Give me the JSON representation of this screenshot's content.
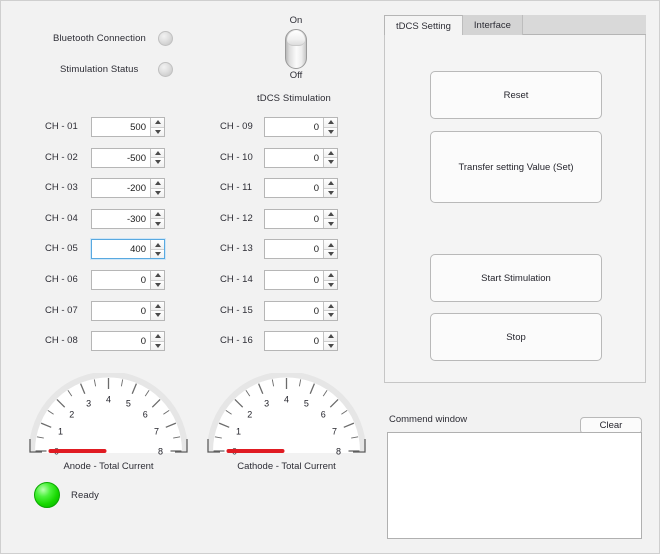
{
  "window": {
    "background": "#f2f2f2"
  },
  "status_indicators": [
    {
      "label": "Bluetooth Connection",
      "state": "off"
    },
    {
      "label": "Stimulation Status",
      "state": "off"
    }
  ],
  "toggle": {
    "on_label": "On",
    "off_label": "Off",
    "caption": "tDCS Stimulation",
    "state": "Off"
  },
  "channels_left": [
    {
      "name": "CH - 01",
      "value": "500",
      "focused": false
    },
    {
      "name": "CH - 02",
      "value": "-500",
      "focused": false
    },
    {
      "name": "CH - 03",
      "value": "-200",
      "focused": false
    },
    {
      "name": "CH - 04",
      "value": "-300",
      "focused": false
    },
    {
      "name": "CH - 05",
      "value": "400",
      "focused": true
    },
    {
      "name": "CH - 06",
      "value": "0",
      "focused": false
    },
    {
      "name": "CH - 07",
      "value": "0",
      "focused": false
    },
    {
      "name": "CH - 08",
      "value": "0",
      "focused": false
    }
  ],
  "channels_right": [
    {
      "name": "CH - 09",
      "value": "0",
      "focused": false
    },
    {
      "name": "CH - 10",
      "value": "0",
      "focused": false
    },
    {
      "name": "CH - 11",
      "value": "0",
      "focused": false
    },
    {
      "name": "CH - 12",
      "value": "0",
      "focused": false
    },
    {
      "name": "CH - 13",
      "value": "0",
      "focused": false
    },
    {
      "name": "CH - 14",
      "value": "0",
      "focused": false
    },
    {
      "name": "CH - 15",
      "value": "0",
      "focused": false
    },
    {
      "name": "CH - 16",
      "value": "0",
      "focused": false
    }
  ],
  "gauges": [
    {
      "caption": "Anode  - Total Current",
      "ticks": [
        "0",
        "1",
        "2",
        "3",
        "4",
        "5",
        "6",
        "7",
        "8"
      ],
      "min": 0,
      "max": 8,
      "value": 0,
      "needle_color": "#e01b22"
    },
    {
      "caption": "Cathode - Total Current",
      "ticks": [
        "0",
        "1",
        "2",
        "3",
        "4",
        "5",
        "6",
        "7",
        "8"
      ],
      "min": 0,
      "max": 8,
      "value": 0,
      "needle_color": "#e01b22"
    }
  ],
  "ready": {
    "label": "Ready",
    "color": "#17d800"
  },
  "tabs": [
    {
      "label": "tDCS Setting",
      "active": true
    },
    {
      "label": "Interface",
      "active": false
    }
  ],
  "panel_buttons": [
    {
      "label": "Reset"
    },
    {
      "label": "Transfer setting Value (Set)"
    },
    {
      "label": "Start Stimulation"
    },
    {
      "label": "Stop"
    }
  ],
  "command_window": {
    "label": "Commend window",
    "clear_label": "Clear",
    "content": ""
  }
}
